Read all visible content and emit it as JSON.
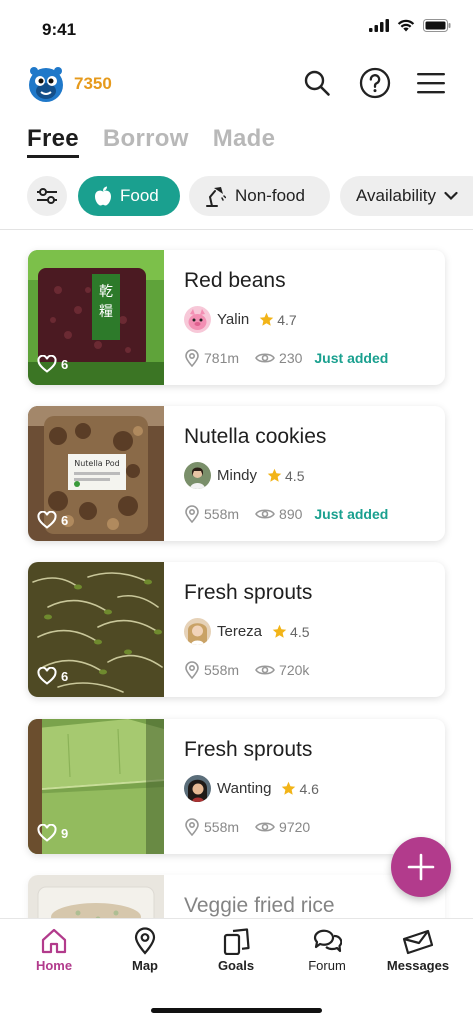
{
  "status": {
    "time": "9:41"
  },
  "header": {
    "points": "7350"
  },
  "tabs": [
    {
      "label": "Free"
    },
    {
      "label": "Borrow"
    },
    {
      "label": "Made"
    }
  ],
  "filters": {
    "food": "Food",
    "nonfood": "Non-food",
    "availability": "Availability"
  },
  "listings": [
    {
      "title": "Red beans",
      "likes": "6",
      "user": "Yalin",
      "rating": "4.7",
      "distance": "781m",
      "views": "230",
      "badge": "Just added"
    },
    {
      "title": "Nutella cookies",
      "likes": "6",
      "user": "Mindy",
      "rating": "4.5",
      "distance": "558m",
      "views": "890",
      "badge": "Just added"
    },
    {
      "title": "Fresh sprouts",
      "likes": "6",
      "user": "Tereza",
      "rating": "4.5",
      "distance": "558m",
      "views": "720k"
    },
    {
      "title": "Fresh sprouts",
      "likes": "9",
      "user": "Wanting",
      "rating": "4.6",
      "distance": "558m",
      "views": "9720"
    },
    {
      "title": "Veggie fried rice"
    }
  ],
  "nav": [
    {
      "label": "Home"
    },
    {
      "label": "Map"
    },
    {
      "label": "Goals"
    },
    {
      "label": "Forum"
    },
    {
      "label": "Messages"
    }
  ],
  "colors": {
    "accent": "#1aa08f",
    "brand": "#b23b8c",
    "points": "#e69a1c"
  }
}
